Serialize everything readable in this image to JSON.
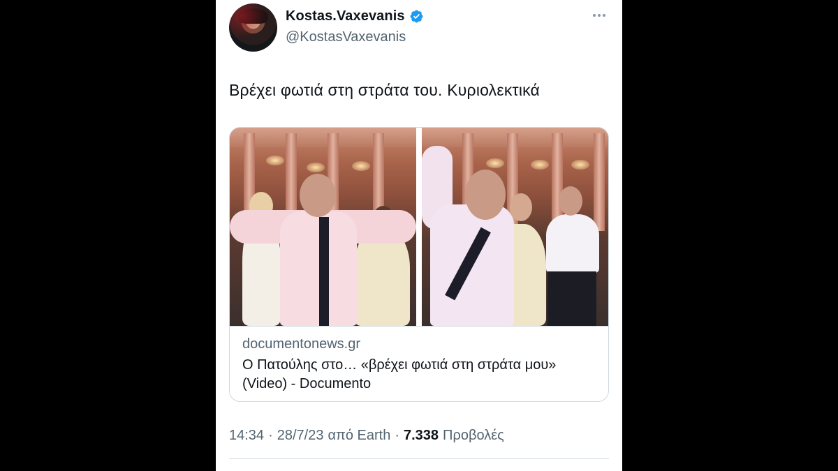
{
  "author": {
    "display_name": "Kostas.Vaxevanis",
    "handle": "@KostasVaxevanis",
    "verified": true
  },
  "tweet": {
    "text": "Βρέχει φωτιά στη στράτα του. Κυριολεκτικά"
  },
  "card": {
    "domain": "documentonews.gr",
    "title": "Ο Πατούλης στο… «βρέχει φωτιά στη στράτα μου» (Video) - Documento",
    "media_count": 2
  },
  "meta": {
    "time": "14:34",
    "date": "28/7/23",
    "source": "από Earth",
    "views_count": "7.338",
    "views_label": "Προβολές"
  },
  "colors": {
    "verified": "#1d9bf0",
    "text_primary": "#0f1419",
    "text_secondary": "#536471",
    "border": "#cfd9de"
  },
  "icons": [
    "verified-badge-icon",
    "more-options-icon"
  ]
}
